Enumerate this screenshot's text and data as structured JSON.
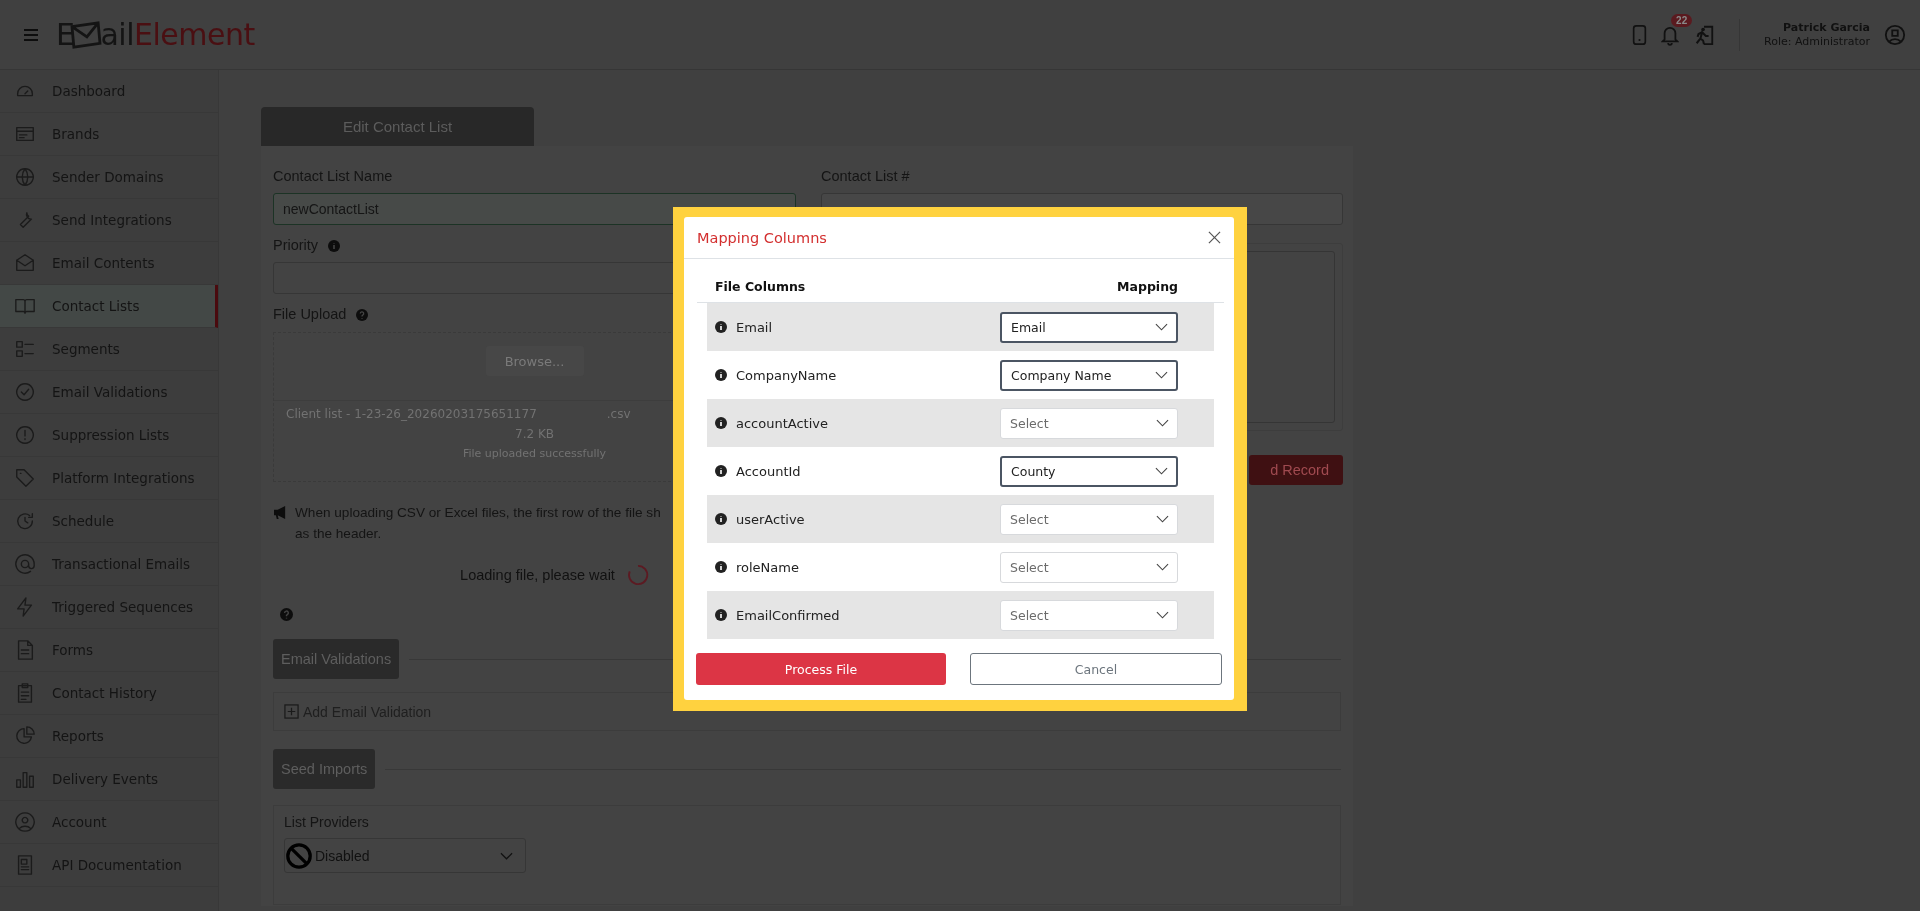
{
  "header": {
    "logo": {
      "start": "E",
      "middle": "ail",
      "end": "Element"
    },
    "notification_count": "22",
    "user": {
      "name": "Patrick Garcia",
      "role": "Role: Administrator"
    }
  },
  "sidebar": {
    "items": [
      {
        "label": "Dashboard",
        "selected": false
      },
      {
        "label": "Brands",
        "selected": false
      },
      {
        "label": "Sender Domains",
        "selected": false
      },
      {
        "label": "Send Integrations",
        "selected": false
      },
      {
        "label": "Email Contents",
        "selected": false
      },
      {
        "label": "Contact Lists",
        "selected": true
      },
      {
        "label": "Segments",
        "selected": false
      },
      {
        "label": "Email Validations",
        "selected": false
      },
      {
        "label": "Suppression Lists",
        "selected": false
      },
      {
        "label": "Platform Integrations",
        "selected": false
      },
      {
        "label": "Schedule",
        "selected": false
      },
      {
        "label": "Transactional Emails",
        "selected": false
      },
      {
        "label": "Triggered Sequences",
        "selected": false
      },
      {
        "label": "Forms",
        "selected": false
      },
      {
        "label": "Contact History",
        "selected": false
      },
      {
        "label": "Reports",
        "selected": false
      },
      {
        "label": "Delivery Events",
        "selected": false
      },
      {
        "label": "Account",
        "selected": false
      },
      {
        "label": "API Documentation",
        "selected": false
      }
    ]
  },
  "tabs": [
    {
      "label": "Edit Contact List",
      "selected": true
    }
  ],
  "form": {
    "name_label": "Contact List Name",
    "name_value": "newContactList",
    "priority_label": "Priority",
    "file_upload_label": "File Upload",
    "browse_button": "Browse...",
    "file_name": "Client list - 1-23-26_20260203175651177",
    "file_ext": ".csv",
    "file_size": "7.2 KB",
    "upload_status": "File uploaded successfully",
    "notice_lines": [
      "When uploading CSV or Excel files, the first row of the file sh",
      "as the header."
    ],
    "loading_text": "Loading file, please wait",
    "number_label": "Contact List #",
    "add_record_button": "d Record"
  },
  "email_validations": {
    "button": "Email Validations",
    "add_link": "Add Email Validation"
  },
  "seed_imports": {
    "button": "Seed Imports",
    "providers_label": "List Providers",
    "providers_value": "Disabled"
  },
  "modal": {
    "title": "Mapping Columns",
    "columns": [
      "File Columns",
      "Mapping"
    ],
    "rows": [
      {
        "column": "Email",
        "value": "Email"
      },
      {
        "column": "CompanyName",
        "value": "Company Name"
      },
      {
        "column": "accountActive",
        "placeholder": "Select"
      },
      {
        "column": "AccountId",
        "value": "County"
      },
      {
        "column": "userActive",
        "placeholder": "Select"
      },
      {
        "column": "roleName",
        "placeholder": "Select"
      },
      {
        "column": "EmailConfirmed",
        "placeholder": "Select"
      }
    ],
    "process_button": "Process File",
    "cancel_button": "Cancel"
  }
}
